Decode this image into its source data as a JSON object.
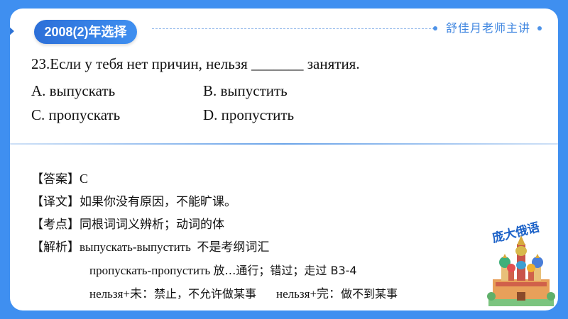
{
  "header": {
    "tab_label": "2008(2)年选择",
    "teacher": "舒佳月老师主讲"
  },
  "question": {
    "stem": "23.Если у тебя нет причин, нельзя _______ занятия.",
    "options": [
      "A. выпускать",
      "B. выпустить",
      "C. пропускать",
      "D. пропустить"
    ]
  },
  "analysis": {
    "answer_label": "【答案】",
    "answer_value": "C",
    "translation_label": "【译文】",
    "translation_value": "如果你没有原因，不能旷课。",
    "point_label": "【考点】",
    "point_value": "同根词词义辨析；动词的体",
    "explain_label": "【解析】",
    "explain_line1": "выпускать-выпустить  不是考纲词汇",
    "explain_line2_ru": "пропускать-пропустить ",
    "explain_line2_cn": "放…通行；错过；走过  B3-4",
    "explain_line3_a": "нельзя+未：",
    "explain_line3_b": "禁止，不允许做某事",
    "explain_line3_c": "нельзя+完：",
    "explain_line3_d": "做不到某事"
  },
  "logo": {
    "text": "庞大俄语"
  },
  "colors": {
    "background": "#3f8ff0",
    "accent": "#2c6fd8"
  }
}
